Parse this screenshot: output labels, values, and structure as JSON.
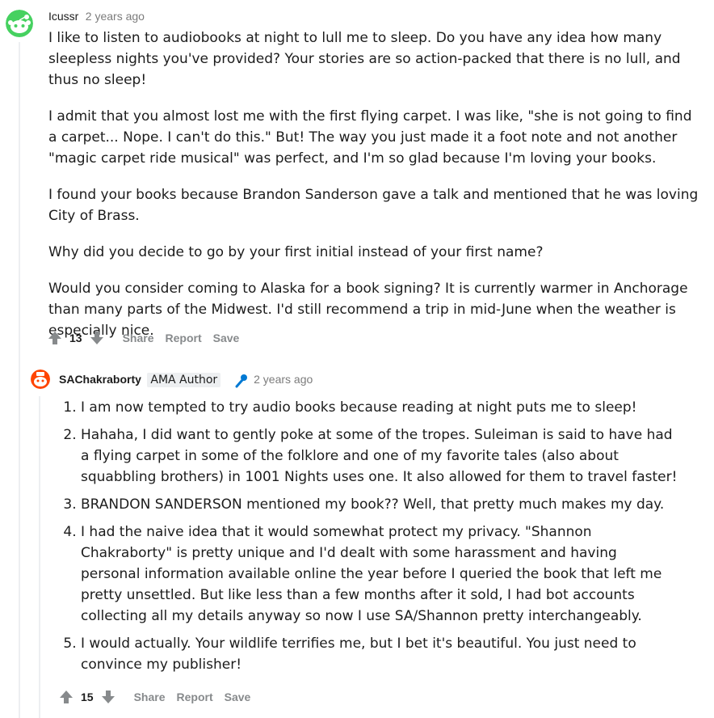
{
  "comment1": {
    "username": "Icussr",
    "time": "2 years ago",
    "paragraphs": [
      "I like to listen to audiobooks at night to lull me to sleep. Do you have any idea how many sleepless nights you've provided? Your stories are so action-packed that there is no lull, and thus no sleep!",
      "I admit that you almost lost me with the first flying carpet. I was like, \"she is not going to find a carpet... Nope. I can't do this.\" But! The way you just made it a foot note and not another \"magic carpet ride musical\" was perfect, and I'm so glad because I'm loving your books.",
      "I found your books because Brandon Sanderson gave a talk and mentioned that he was loving City of Brass.",
      "Why did you decide to go by your first initial instead of your first name?",
      "Would you consider coming to Alaska for a book signing? It is currently warmer in Anchorage than many parts of the Midwest. I'd still recommend a trip in mid-June when the weather is especially nice."
    ],
    "votes": "13",
    "actions": {
      "share": "Share",
      "report": "Report",
      "save": "Save"
    }
  },
  "comment2": {
    "username": "SAChakraborty",
    "flair": "AMA Author",
    "time": "2 years ago",
    "items": [
      "I am now tempted to try audio books because reading at night puts me to sleep!",
      "Hahaha, I did want to gently poke at some of the tropes. Suleiman is said to have had a flying carpet in some of the folklore and one of my favorite tales (also about squabbling brothers) in 1001 Nights uses one. It also allowed for them to travel faster!",
      "BRANDON SANDERSON mentioned my book?? Well, that pretty much makes my day.",
      "I had the naive idea that it would somewhat protect my privacy. \"Shannon Chakraborty\" is pretty unique and I'd dealt with some harassment and having personal information available online the year before I queried the book that left me pretty unsettled. But like less than a few months after it sold, I had bot accounts collecting all my details anyway so now I use SA/Shannon pretty interchangeably.",
      "I would actually. Your wildlife terrifies me, but I bet it's beautiful. You just need to convince my publisher!"
    ],
    "votes": "15",
    "actions": {
      "share": "Share",
      "report": "Report",
      "save": "Save"
    }
  },
  "icons": {
    "avatar1": "snoo-avatar-green",
    "avatar2": "snoo-avatar-red",
    "upvote": "upvote-arrow-icon",
    "downvote": "downvote-arrow-icon",
    "mic": "microphone-icon"
  }
}
